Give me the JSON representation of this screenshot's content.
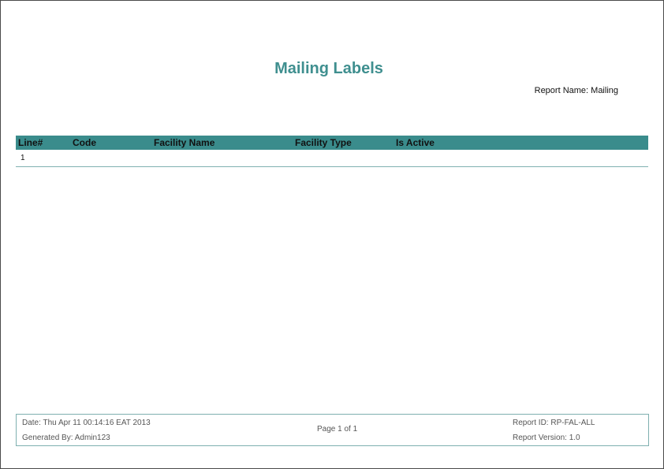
{
  "report": {
    "title": "Mailing Labels",
    "report_name": "Report Name: Mailing"
  },
  "table": {
    "columns": [
      "Line#",
      "Code",
      "Facility Name",
      "Facility Type",
      "Is Active"
    ],
    "rows": [
      {
        "line": "1",
        "code": "",
        "facility_name": "",
        "facility_type": "",
        "is_active": ""
      }
    ]
  },
  "footer": {
    "date": "Date: Thu Apr 11 00:14:16 EAT 2013",
    "generated_by": "Generated By: Admin123",
    "page": "Page 1 of 1",
    "report_id": "Report ID: RP-FAL-ALL",
    "report_version": "Report Version: 1.0"
  },
  "colors": {
    "accent": "#3a8c8c",
    "title": "#3f8f8f",
    "rule": "#7fb0b0"
  }
}
